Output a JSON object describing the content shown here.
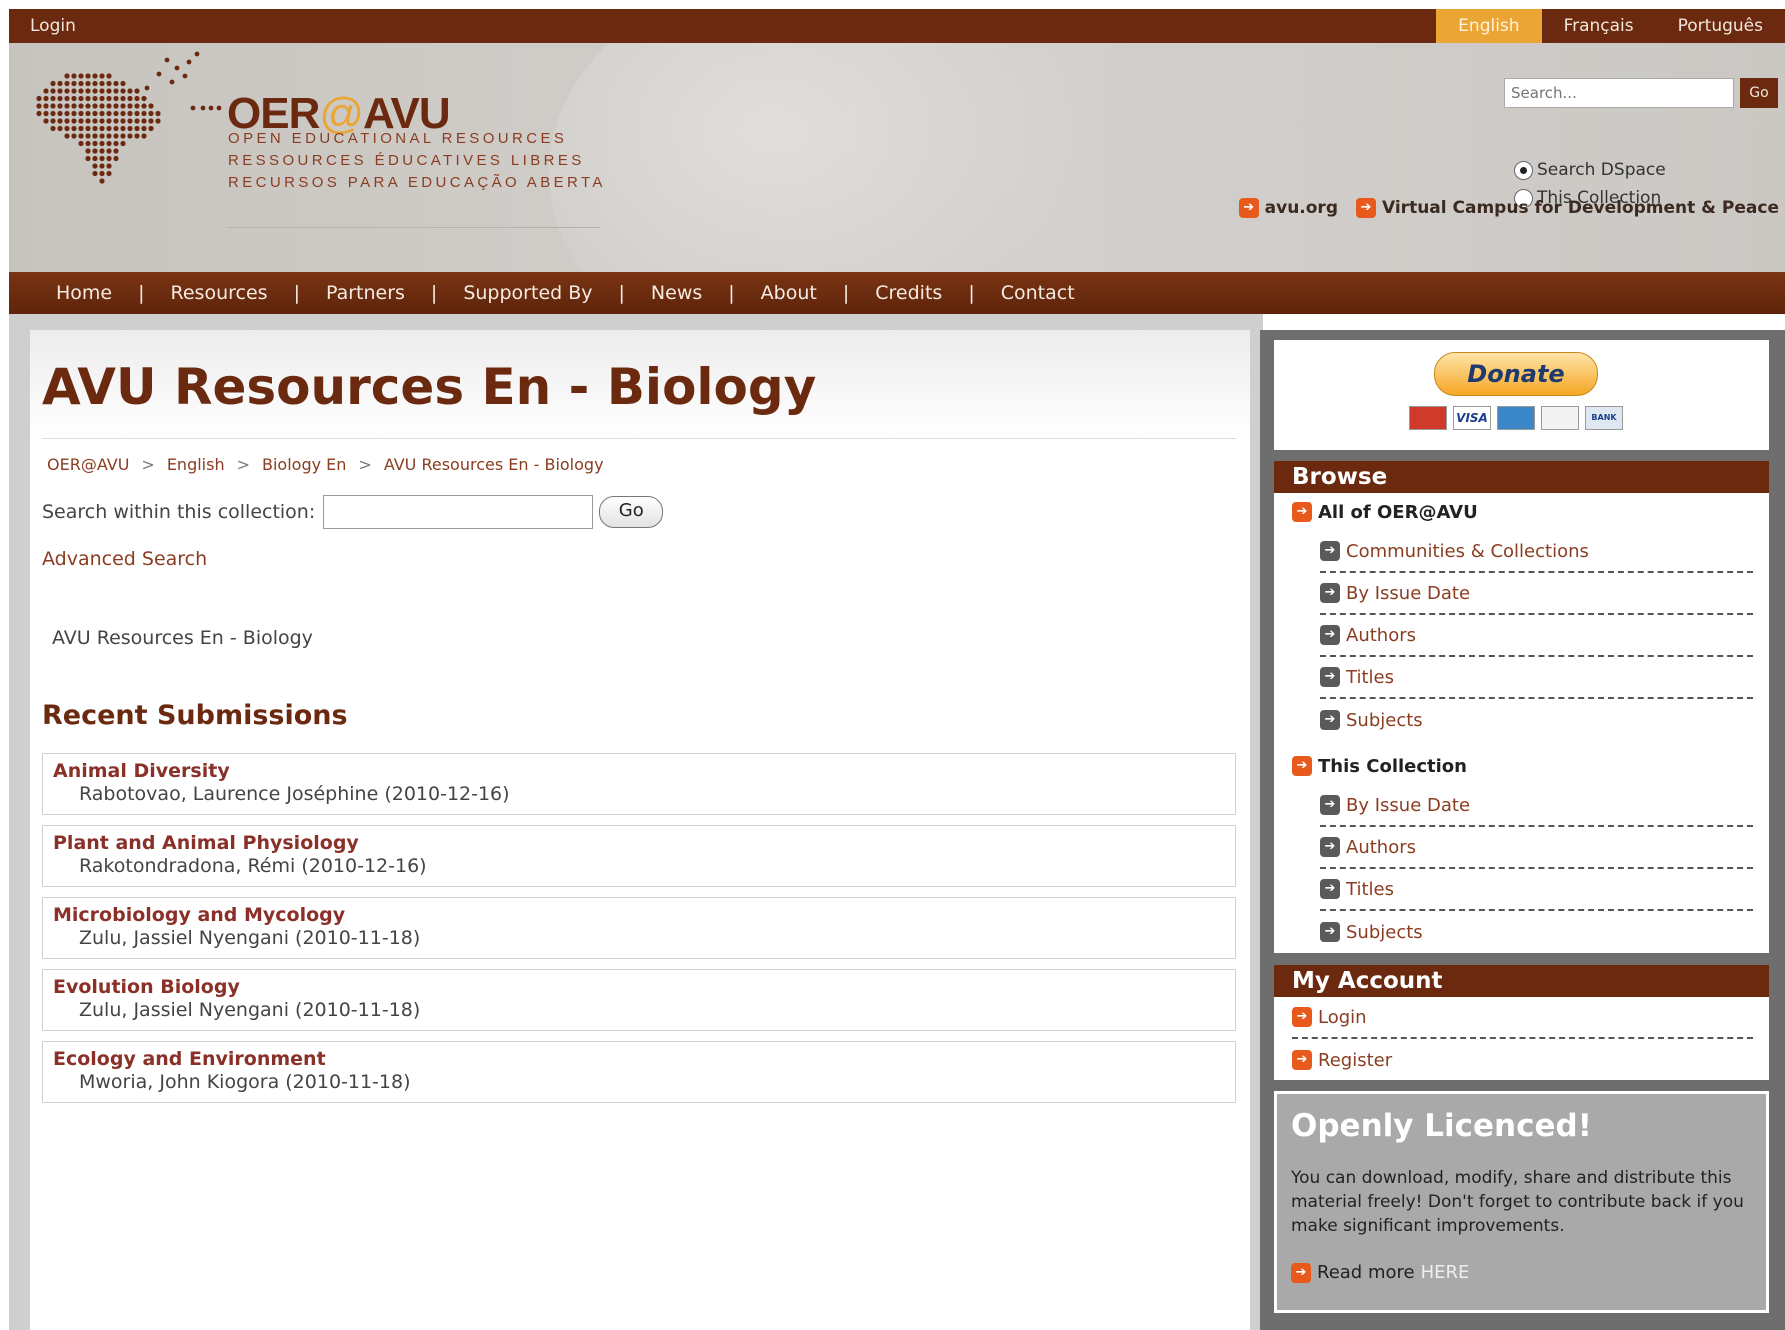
{
  "topbar": {
    "login": "Login",
    "languages": [
      {
        "label": "English",
        "active": true
      },
      {
        "label": "Français",
        "active": false
      },
      {
        "label": "Português",
        "active": false
      }
    ]
  },
  "header": {
    "brand_left": "OER",
    "brand_at": "@",
    "brand_right": "AVU",
    "tagline_en": "OPEN EDUCATIONAL RESOURCES",
    "tagline_fr": "RESSOURCES ÉDUCATIVES LIBRES",
    "tagline_pt": "RECURSOS PARA EDUCAÇÃO ABERTA",
    "search_placeholder": "Search...",
    "search_go": "Go",
    "scope_options": [
      "Search DSpace",
      "This Collection"
    ],
    "selected_scope": "Search DSpace",
    "ext_links": [
      "avu.org",
      "Virtual Campus for Development & Peace"
    ]
  },
  "nav": [
    "Home",
    "Resources",
    "Partners",
    "Supported By",
    "News",
    "About",
    "Credits",
    "Contact"
  ],
  "nav_separator": "|",
  "main": {
    "title": "AVU Resources En - Biology",
    "breadcrumb": [
      "OER@AVU",
      "English",
      "Biology En",
      "AVU Resources En - Biology"
    ],
    "breadcrumb_separator": ">",
    "search_label": "Search within this collection:",
    "search_go": "Go",
    "advanced_search": "Advanced Search",
    "collection_description": "AVU Resources En - Biology",
    "recent_title": "Recent Submissions",
    "submissions": [
      {
        "title": "Animal Diversity",
        "meta": "Rabotovao, Laurence Joséphine (2010-12-16)"
      },
      {
        "title": "Plant and Animal Physiology",
        "meta": "Rakotondradona, Rémi (2010-12-16)"
      },
      {
        "title": "Microbiology and Mycology",
        "meta": "Zulu, Jassiel Nyengani (2010-11-18)"
      },
      {
        "title": "Evolution Biology",
        "meta": "Zulu, Jassiel Nyengani (2010-11-18)"
      },
      {
        "title": "Ecology and Environment",
        "meta": "Mworia, John Kiogora (2010-11-18)"
      }
    ]
  },
  "sidebar": {
    "donate": "Donate",
    "cards": [
      "MasterCard",
      "VISA",
      "AMEX",
      "DISCOVER",
      "BANK"
    ],
    "browse_title": "Browse",
    "all_title": "All of OER@AVU",
    "all_items": [
      "Communities & Collections",
      "By Issue Date",
      "Authors",
      "Titles",
      "Subjects"
    ],
    "collection_title": "This Collection",
    "collection_items": [
      "By Issue Date",
      "Authors",
      "Titles",
      "Subjects"
    ],
    "account_title": "My Account",
    "account_items": [
      "Login",
      "Register"
    ],
    "licence_title": "Openly Licenced!",
    "licence_text": "You can download, modify, share and distribute this material freely! Don't forget to contribute back if you make significant improvements.",
    "read_more": "Read more",
    "here": "HERE"
  },
  "colors": {
    "brand_brown": "#6b2a10",
    "accent_orange": "#eaa535",
    "link_red": "#8a3d20"
  }
}
